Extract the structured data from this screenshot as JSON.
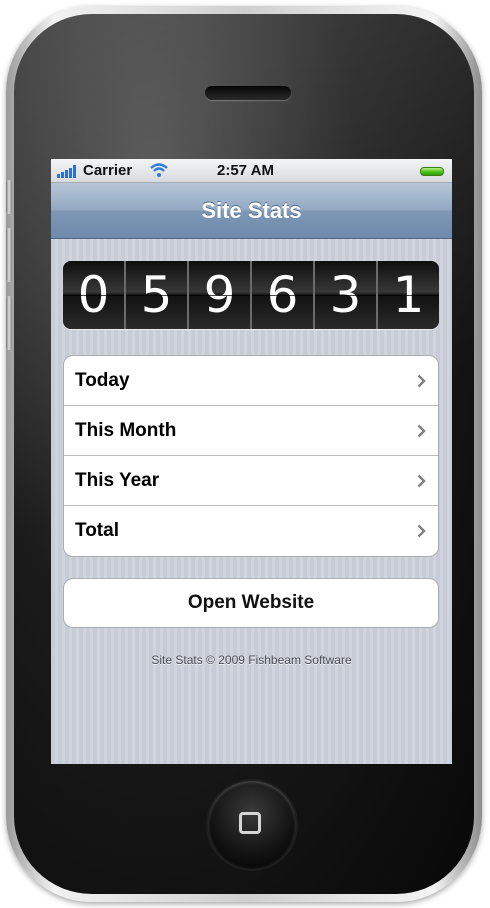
{
  "status_bar": {
    "carrier": "Carrier",
    "time": "2:57 AM",
    "signal_icon": "signal-bars-icon",
    "wifi_icon": "wifi-icon",
    "battery_icon": "battery-icon",
    "battery_color": "#55c51b"
  },
  "nav": {
    "title": "Site Stats"
  },
  "counter": {
    "digits": [
      "0",
      "5",
      "9",
      "6",
      "3",
      "1"
    ]
  },
  "stats_list": [
    {
      "label": "Today"
    },
    {
      "label": "This Month"
    },
    {
      "label": "This Year"
    },
    {
      "label": "Total"
    }
  ],
  "actions": {
    "open_website_label": "Open Website"
  },
  "footer": {
    "text": "Site Stats © 2009 Fishbeam Software"
  },
  "theme": {
    "nav_bar_color": "#7d97b5",
    "background_color": "#c7ccd6"
  }
}
